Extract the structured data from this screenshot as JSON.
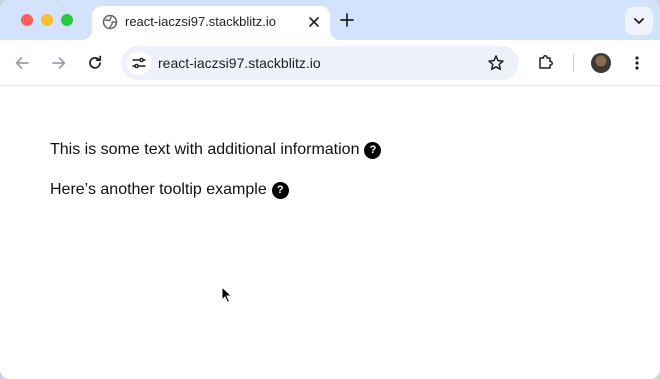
{
  "browser": {
    "tab": {
      "title": "react-iaczsi97.stackblitz.io",
      "favicon": "globe-icon"
    },
    "address_bar": {
      "url": "react-iaczsi97.stackblitz.io"
    },
    "colors": {
      "tabstrip": "#d3e3fd",
      "omnibox": "#edf2fa"
    }
  },
  "page": {
    "lines": [
      {
        "text": "This is some text with additional information",
        "icon_label": "?"
      },
      {
        "text": "Here’s another tooltip example",
        "icon_label": "?"
      }
    ]
  }
}
